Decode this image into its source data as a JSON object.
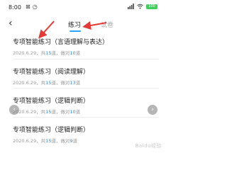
{
  "status_bar": {
    "time": "8:00",
    "icons": [
      "notification-icon",
      "alarm-icon"
    ],
    "right_icons": [
      "signal-icon",
      "wifi-icon"
    ],
    "battery": "100"
  },
  "header": {
    "back_icon": "back-arrow-icon",
    "tabs": [
      {
        "label": "练习",
        "active": true
      },
      {
        "label": "试卷",
        "active": false
      }
    ]
  },
  "list": {
    "items": [
      {
        "title": "专项智能练习（言语理解与表达）",
        "date": "2020.6.29",
        "count_prefix": "共",
        "count": "15",
        "count_suffix": "道",
        "done_prefix": "做对",
        "done": "10",
        "done_suffix": "道"
      },
      {
        "title": "专项智能练习（阅读理解）",
        "date": "2020.6.29",
        "count_prefix": "共",
        "count": "15",
        "count_suffix": "道",
        "done_prefix": "做对",
        "done": "13",
        "done_suffix": "道"
      },
      {
        "title": "专项智能练习（逻辑判断）",
        "date": "2020.6.29",
        "count_prefix": "共",
        "count": "15",
        "count_suffix": "道",
        "done_prefix": "做对",
        "done": "10",
        "done_suffix": "道"
      },
      {
        "title": "专项智能练习（逻辑判断）",
        "date": "2020.6.29",
        "count_prefix": "共",
        "count": "15",
        "count_suffix": "道",
        "done_prefix": "做对",
        "done": "9",
        "done_suffix": "道"
      }
    ]
  },
  "overlay": {
    "prev_label": "‹",
    "next_label": "›",
    "annotation_color": "#e53935"
  },
  "watermark": "Baidu经验"
}
